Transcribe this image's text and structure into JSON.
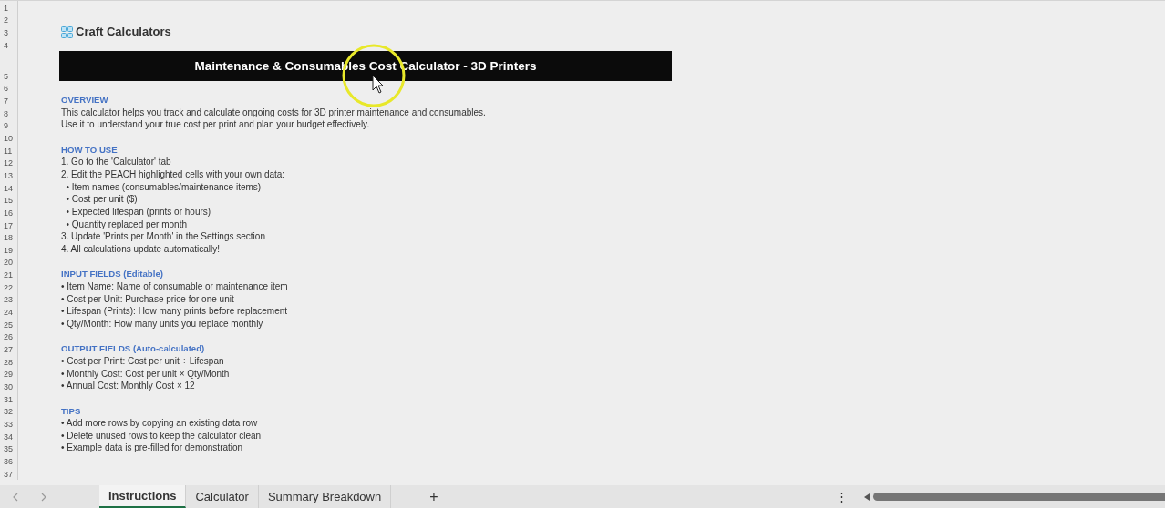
{
  "rows": [
    {
      "number": "1"
    },
    {
      "number": "2"
    },
    {
      "number": "3",
      "kind": "logo",
      "text": "Craft Calculators"
    },
    {
      "number": "4"
    },
    {
      "number": "5",
      "kind": "banner",
      "text": "Maintenance & Consumables Cost Calculator - 3D Printers"
    },
    {
      "number": "6"
    },
    {
      "number": "7",
      "kind": "heading",
      "text": "OVERVIEW"
    },
    {
      "number": "8",
      "kind": "text",
      "text": "This calculator helps you track and calculate ongoing costs for 3D printer maintenance and consumables."
    },
    {
      "number": "9",
      "kind": "text",
      "text": "Use it to understand your true cost per print and plan your budget effectively."
    },
    {
      "number": "10"
    },
    {
      "number": "11",
      "kind": "heading",
      "text": "HOW TO USE"
    },
    {
      "number": "12",
      "kind": "text",
      "text": "1. Go to the 'Calculator' tab"
    },
    {
      "number": "13",
      "kind": "text",
      "text": "2. Edit the PEACH highlighted cells with your own data:"
    },
    {
      "number": "14",
      "kind": "text",
      "text": "  • Item names (consumables/maintenance items)"
    },
    {
      "number": "15",
      "kind": "text",
      "text": "  • Cost per unit ($)"
    },
    {
      "number": "16",
      "kind": "text",
      "text": "  • Expected lifespan (prints or hours)"
    },
    {
      "number": "17",
      "kind": "text",
      "text": "  • Quantity replaced per month"
    },
    {
      "number": "18",
      "kind": "text",
      "text": "3. Update 'Prints per Month' in the Settings section"
    },
    {
      "number": "19",
      "kind": "text",
      "text": "4. All calculations update automatically!"
    },
    {
      "number": "20"
    },
    {
      "number": "21",
      "kind": "heading",
      "text": "INPUT FIELDS (Editable)"
    },
    {
      "number": "22",
      "kind": "text",
      "text": "• Item Name: Name of consumable or maintenance item"
    },
    {
      "number": "23",
      "kind": "text",
      "text": "• Cost per Unit: Purchase price for one unit"
    },
    {
      "number": "24",
      "kind": "text",
      "text": "• Lifespan (Prints): How many prints before replacement"
    },
    {
      "number": "25",
      "kind": "text",
      "text": "• Qty/Month: How many units you replace monthly"
    },
    {
      "number": "26"
    },
    {
      "number": "27",
      "kind": "heading",
      "text": "OUTPUT FIELDS (Auto-calculated)"
    },
    {
      "number": "28",
      "kind": "text",
      "text": "• Cost per Print: Cost per unit ÷ Lifespan"
    },
    {
      "number": "29",
      "kind": "text",
      "text": "• Monthly Cost: Cost per unit × Qty/Month"
    },
    {
      "number": "30",
      "kind": "text",
      "text": "• Annual Cost: Monthly Cost × 12"
    },
    {
      "number": "31"
    },
    {
      "number": "32",
      "kind": "heading",
      "text": "TIPS"
    },
    {
      "number": "33",
      "kind": "text",
      "text": "• Add more rows by copying an existing data row"
    },
    {
      "number": "34",
      "kind": "text",
      "text": "• Delete unused rows to keep the calculator clean"
    },
    {
      "number": "35",
      "kind": "text",
      "text": "• Example data is pre-filled for demonstration"
    },
    {
      "number": "36"
    },
    {
      "number": "37"
    }
  ],
  "sheet_tabs": [
    {
      "label": "Instructions",
      "selected": true
    },
    {
      "label": "Calculator",
      "selected": false
    },
    {
      "label": "Summary Breakdown",
      "selected": false
    }
  ],
  "add_sheet": "+",
  "more": "⋮"
}
